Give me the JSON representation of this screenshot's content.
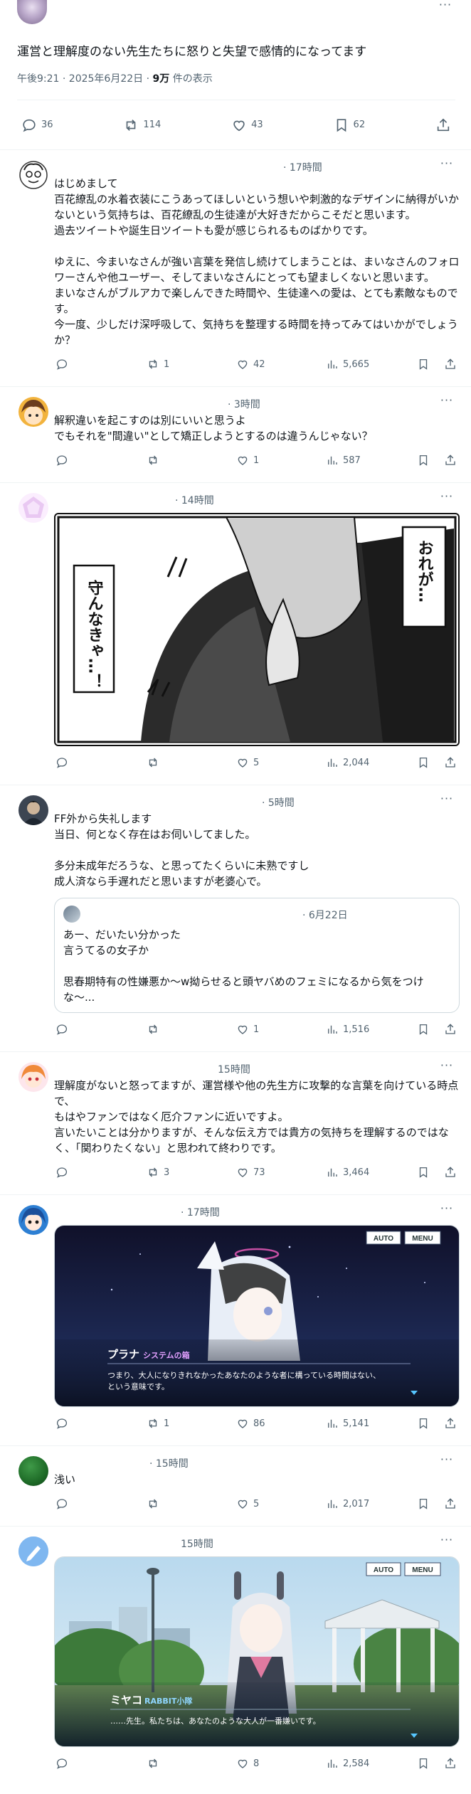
{
  "main_tweet": {
    "text": "運営と理解度のない先生たちに怒りと失望で感情的になってます",
    "meta_prefix": "午後9:21 · 2025年6月22日 · ",
    "views_bold": "9万",
    "views_suffix": " 件の表示",
    "replies": "36",
    "retweets": "114",
    "likes": "43",
    "bookmarks": "62"
  },
  "more_glyph": "···",
  "replies": [
    {
      "time": "· 17時間",
      "text": "はじめまして\n百花繚乱の水着衣装にこうあってほしいという想いや刺激的なデザインに納得がいかないという気持ちは、百花繚乱の生徒達が大好きだからこそだと思います。\n過去ツイートや誕生日ツイートも愛が感じられるものばかりです。\n\nゆえに、今まいなさんが強い言葉を発信し続けてしまうことは、まいなさんのフォロワーさんや他ユーザー、そしてまいなさんにとっても望ましくないと思います。\nまいなさんがブルアカで楽しんできた時間や、生徒達への愛は、とても素敵なものです。\n今一度、少しだけ深呼吸して、気持ちを整理する時間を持ってみてはいかがでしょうか？",
      "retweets": "1",
      "likes": "42",
      "views": "5,665"
    },
    {
      "time": "· 3時間",
      "text": "解釈違いを起こすのは別にいいと思うよ\nでもそれを\"間違い\"として矯正しようとするのは違うんじゃない？",
      "retweets": "",
      "likes": "1",
      "views": "587"
    },
    {
      "time": "· 14時間",
      "manga_left": "守んなきゃ…！",
      "manga_right": "おれが…",
      "retweets": "",
      "likes": "5",
      "views": "2,044"
    },
    {
      "time": "· 5時間",
      "text": "FF外から失礼します\n当日、何となく存在はお伺いしてました。\n\n多分未成年だろうな、と思ってたくらいに未熟ですし\n成人済なら手遅れだと思いますが老婆心で。",
      "quote_time": "· 6月22日",
      "quote_text": "あー、だいたい分かった\n言うてるの女子か\n\n思春期特有の性嫌悪か〜w拗らせると頭ヤバめのフェミになるから気をつけな〜...",
      "retweets": "",
      "likes": "1",
      "views": "1,516"
    },
    {
      "time": "15時間",
      "text": "理解度がないと怒ってますが、運営様や他の先生方に攻撃的な言葉を向けている時点で、\nもはやファンではなく厄介ファンに近いですよ。\n言いたいことは分かりますが、そんな伝え方では貴方の気持ちを理解するのではなく、「関わりたくない」と思われて終わりです。",
      "retweets": "3",
      "likes": "73",
      "views": "3,464"
    },
    {
      "time": "· 17時間",
      "game_auto": "AUTO",
      "game_menu": "MENU",
      "game_name": "プラナ",
      "game_tag": "システムの箱",
      "game_line1": "つまり、大人になりきれなかったあなたのような者に構っている時間はない、",
      "game_line2": "という意味です。",
      "retweets": "1",
      "likes": "86",
      "views": "5,141"
    },
    {
      "time": "· 15時間",
      "text": "浅い",
      "retweets": "",
      "likes": "5",
      "views": "2,017"
    },
    {
      "time": "15時間",
      "game_auto": "AUTO",
      "game_menu": "MENU",
      "game_name": "ミヤコ",
      "game_tag": "RABBIT小隊",
      "game_line1": "……先生。私たちは、あなたのような大人が一番嫌いです。",
      "retweets": "",
      "likes": "8",
      "views": "2,584"
    }
  ],
  "colors": {
    "text": "#0f1419",
    "muted": "#536471",
    "border": "#eff3f4"
  }
}
